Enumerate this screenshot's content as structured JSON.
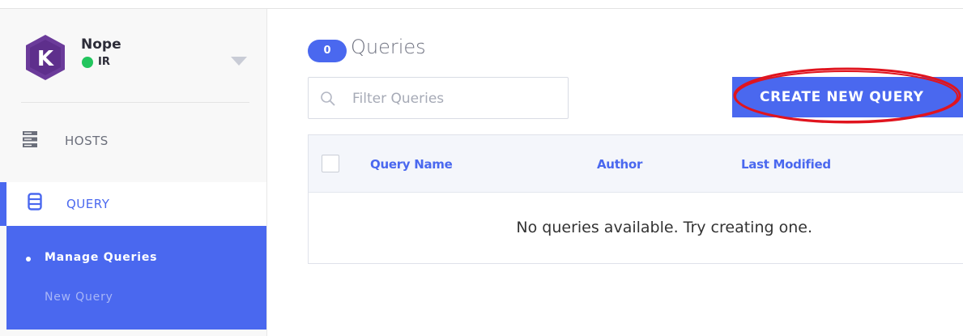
{
  "sidebar": {
    "user": {
      "name": "Nope",
      "team": "IR",
      "avatar_letter": "K"
    },
    "nav": [
      {
        "label": "HOSTS",
        "icon": "hosts-icon"
      },
      {
        "label": "QUERY",
        "icon": "database-icon"
      }
    ],
    "submenu": [
      {
        "label": "Manage Queries"
      },
      {
        "label": "New Query"
      }
    ]
  },
  "main": {
    "query_count": "0",
    "title": "Queries",
    "filter": {
      "placeholder": "Filter Queries",
      "value": ""
    },
    "create_button": "CREATE NEW QUERY",
    "table": {
      "columns": [
        "Query Name",
        "Author",
        "Last Modified"
      ],
      "empty_message": "No queries available. Try creating one."
    }
  },
  "colors": {
    "accent": "#4a68ef",
    "status_online": "#23c55e",
    "avatar": "#6b3b9a",
    "highlight_circle": "#e0141e"
  }
}
